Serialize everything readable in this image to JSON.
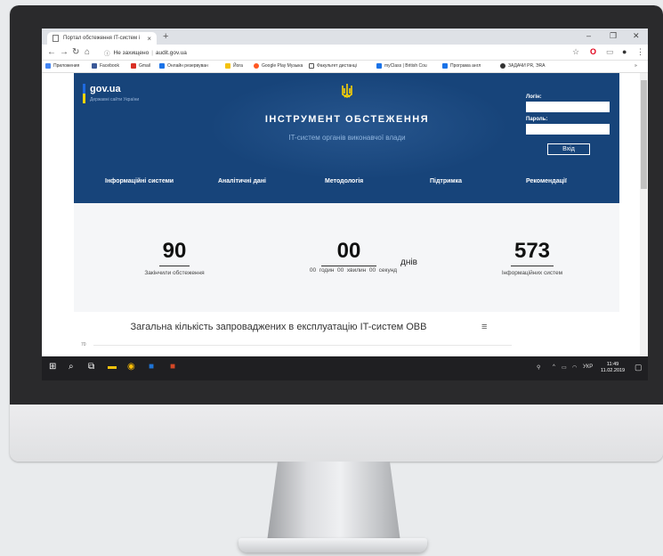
{
  "browser": {
    "tab_title": "Портал обстеження IT-систем і",
    "address_security": "Не захищено",
    "address_url": "audit.gov.ua",
    "bookmarks": [
      {
        "label": "Приложения",
        "color": "#4285f4"
      },
      {
        "label": "Facebook",
        "color": "#3b5998"
      },
      {
        "label": "Gmail",
        "color": "#d93025"
      },
      {
        "label": "Онлайн резервуван",
        "color": "#1a73e8"
      },
      {
        "label": "Йога",
        "color": "#f4c20d"
      },
      {
        "label": "Google Play Музыка",
        "color": "#ff5722"
      },
      {
        "label": "Факультет дистанці",
        "color": "#555555"
      },
      {
        "label": "myClass | British Cou",
        "color": "#1a73e8"
      },
      {
        "label": "Програма англ",
        "color": "#1a73e8"
      },
      {
        "label": "ЗАДАЧИ PR, ЭRA",
        "color": "#333333"
      }
    ]
  },
  "header": {
    "brand": "gov.ua",
    "brand_sub": "Державні сайти України",
    "title": "Інструмент обстеження",
    "subtitle": "IT-систем органів виконавчої влади",
    "login_label": "Логін:",
    "password_label": "Пароль:",
    "login_button": "Вхід",
    "menu": [
      "Інформаційні системи",
      "Аналітичні дані",
      "Методологія",
      "Підтримка",
      "Рекомендації"
    ]
  },
  "stats": {
    "completed_value": "90",
    "completed_label": "Закінчили обстеження",
    "timer_days": "00",
    "timer_days_label": "днів",
    "timer_rest": "00  годин  00  хвилин  00  секунд",
    "systems_value": "573",
    "systems_label": "Інформаційних систем"
  },
  "chart": {
    "title": "Загальна кількість запроваджених в експлуатацію IT-систем ОВВ",
    "ytick_top": "70"
  },
  "taskbar": {
    "language": "УКР",
    "time": "11:49",
    "date": "11.02.2019"
  },
  "colors": {
    "hero_bg": "#17447a",
    "stats_bg": "#f5f6f8",
    "taskbar_bg": "#1f1f22"
  }
}
